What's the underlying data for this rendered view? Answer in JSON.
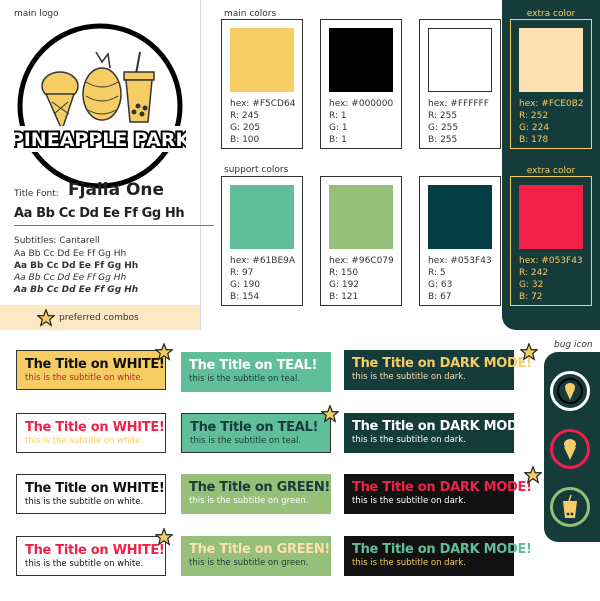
{
  "brand": {
    "main_logo_label": "main logo",
    "logo_text": "PINEAPPLE PARK",
    "title_font_label": "Title Font:",
    "title_font_name": "Fjalla One",
    "title_font_sample": "Aa Bb Cc Dd Ee Ff Gg Hh",
    "subtitles_label": "Subtitles: Cantarell",
    "subtitle_samples": [
      "Aa Bb Cc Dd Ee Ff Gg Hh",
      "Aa Bb Cc Dd Ee Ff Gg Hh",
      "Aa Bb Cc Dd Ee Ff Gg Hh",
      "Aa Bb Cc Dd Ee Ff Gg Hh"
    ],
    "preferred_combos": "preferred combos"
  },
  "main_colors": {
    "label": "main colors",
    "swatches": [
      {
        "hex_label": "hex: #F5CD64",
        "r": "R: 245",
        "g": "G: 205",
        "b": "B: 100",
        "color": "#F5CD64"
      },
      {
        "hex_label": "hex: #000000",
        "r": "R: 1",
        "g": "G: 1",
        "b": "B: 1",
        "color": "#000000"
      },
      {
        "hex_label": "hex: #FFFFFF",
        "r": "R: 255",
        "g": "G: 255",
        "b": "B: 255",
        "color": "#FFFFFF"
      }
    ]
  },
  "extra_color": {
    "label": "extra color",
    "swatch": {
      "hex_label": "hex: #FCE0B2",
      "r": "R: 252",
      "g": "G: 224",
      "b": "B: 178",
      "color": "#FCE0B2"
    }
  },
  "support_colors": {
    "label": "support colors",
    "swatches": [
      {
        "hex_label": "hex: #61BE9A",
        "r": "R: 97",
        "g": "G: 190",
        "b": "B: 154",
        "color": "#61BE9A"
      },
      {
        "hex_label": "hex: #96C079",
        "r": "R: 150",
        "g": "G: 192",
        "b": "B: 121",
        "color": "#96C079"
      },
      {
        "hex_label": "hex: #053F43",
        "r": "R: 5",
        "g": "G: 63",
        "b": "B: 67",
        "color": "#053F43"
      }
    ]
  },
  "extra_color_2": {
    "label": "extra color",
    "swatch": {
      "hex_label": "hex: #053F43",
      "r": "R: 242",
      "g": "G: 32",
      "b": "B: 72",
      "color": "#F22048"
    }
  },
  "combos": {
    "col1": [
      {
        "title": "The Title on WHITE!",
        "subtitle": "this is the subtitle on white."
      },
      {
        "title": "The Title on WHITE!",
        "subtitle": "this is the subtitle on white."
      },
      {
        "title": "The Title on WHITE!",
        "subtitle": "this is the subtitle on white."
      },
      {
        "title": "The Title on WHITE!",
        "subtitle": "this is the subtitle on white."
      }
    ],
    "col2": [
      {
        "title": "The Title on TEAL!",
        "subtitle": "this is the subtitle on teal."
      },
      {
        "title": "The Title on TEAL!",
        "subtitle": "this is the subtitle on teal."
      },
      {
        "title": "The Title on GREEN!",
        "subtitle": "this is the subtitle on green."
      },
      {
        "title": "The Title on GREEN!",
        "subtitle": "this is the subtitle on green."
      }
    ],
    "col3": [
      {
        "title": "The Title on DARK MODE!",
        "subtitle": "this is the subtitle on dark."
      },
      {
        "title": "The Title on DARK MODE!",
        "subtitle": "this is the subtitle on dark."
      },
      {
        "title": "The Title on DARK MODE!",
        "subtitle": "this is the subtitle on dark."
      },
      {
        "title": "The Title on DARK MODE!",
        "subtitle": "this is the subtitle on dark."
      }
    ]
  },
  "bug_icon": {
    "label": "bug icon",
    "icons": [
      "ice-cream-icon",
      "cone-icon",
      "boba-icon"
    ]
  },
  "colors": {
    "gold": "#F5CD64",
    "teal": "#61BE9A",
    "green": "#96C079",
    "dark": "#153B3A",
    "red": "#F22048",
    "peach": "#FCE0B2"
  }
}
